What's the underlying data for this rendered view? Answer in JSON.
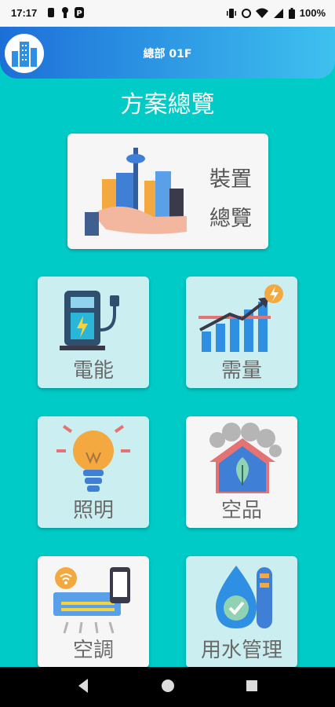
{
  "status_bar": {
    "time": "17:17",
    "battery": "100%"
  },
  "header": {
    "title": "總部 01F"
  },
  "page": {
    "title": "方案總覽"
  },
  "overview_card": {
    "line1": "裝置",
    "line2": "總覽"
  },
  "tiles": [
    {
      "label": "電能"
    },
    {
      "label": "需量"
    },
    {
      "label": "照明"
    },
    {
      "label": "空品"
    },
    {
      "label": "空調"
    },
    {
      "label": "用水管理"
    }
  ],
  "colors": {
    "header_start": "#1d6fd8",
    "header_end": "#3ec1ef",
    "background": "#00cbc7",
    "tile": "#cbeff1"
  },
  "icons": [
    "building-logo-icon",
    "city-hand-icon",
    "ev-charger-icon",
    "demand-chart-icon",
    "light-bulb-icon",
    "air-quality-house-icon",
    "air-conditioner-icon",
    "water-drop-icon"
  ]
}
